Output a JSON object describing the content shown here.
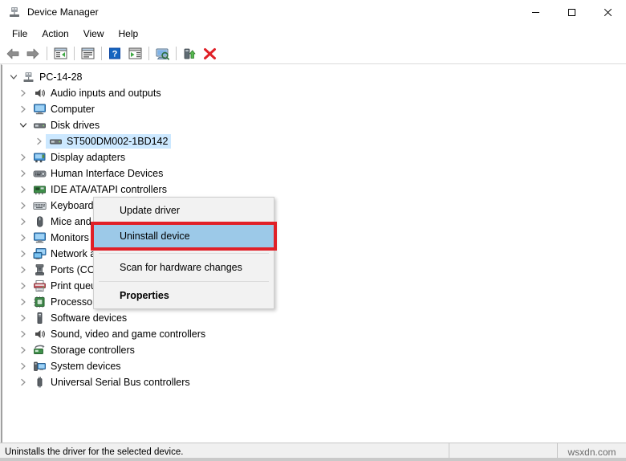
{
  "window": {
    "title": "Device Manager",
    "icon": "device-manager-icon",
    "controls": {
      "minimize": "‒",
      "maximize": "□",
      "close": "✕"
    }
  },
  "menubar": {
    "items": [
      {
        "label": "File"
      },
      {
        "label": "Action"
      },
      {
        "label": "View"
      },
      {
        "label": "Help"
      }
    ]
  },
  "toolbar": {
    "buttons": [
      {
        "name": "back-icon",
        "tip": "Back"
      },
      {
        "name": "forward-icon",
        "tip": "Forward"
      },
      {
        "name": "separator-1",
        "tip": ""
      },
      {
        "name": "show-hide-console-tree-icon",
        "tip": "Show/Hide Console Tree"
      },
      {
        "name": "separator-2",
        "tip": ""
      },
      {
        "name": "properties-icon",
        "tip": "Properties"
      },
      {
        "name": "separator-3",
        "tip": ""
      },
      {
        "name": "help-icon",
        "tip": "Help"
      },
      {
        "name": "view-icon",
        "tip": "View"
      },
      {
        "name": "separator-4",
        "tip": ""
      },
      {
        "name": "scan-for-hardware-changes-icon",
        "tip": "Scan for hardware changes"
      },
      {
        "name": "separator-5",
        "tip": ""
      },
      {
        "name": "update-driver-icon",
        "tip": "Update driver"
      },
      {
        "name": "uninstall-device-icon",
        "tip": "Uninstall device"
      }
    ]
  },
  "tree": {
    "root": {
      "label": "PC-14-28",
      "icon": "computer-root-icon",
      "expanded": true
    },
    "items": [
      {
        "label": "Audio inputs and outputs",
        "icon": "speaker-icon",
        "level": 1,
        "expanded": false
      },
      {
        "label": "Computer",
        "icon": "monitor-icon",
        "level": 1,
        "expanded": false
      },
      {
        "label": "Disk drives",
        "icon": "disk-drive-icon",
        "level": 1,
        "expanded": true
      },
      {
        "label": "ST500DM002-1BD142",
        "icon": "disk-drive-icon",
        "level": 2,
        "expanded": false,
        "selected": true
      },
      {
        "label": "Display adapters",
        "icon": "display-adapter-icon",
        "level": 1,
        "expanded": false
      },
      {
        "label": "Human Interface Devices",
        "icon": "hid-icon",
        "level": 1,
        "expanded": false
      },
      {
        "label": "IDE ATA/ATAPI controllers",
        "icon": "ide-controller-icon",
        "level": 1,
        "expanded": false
      },
      {
        "label": "Keyboards",
        "icon": "keyboard-icon",
        "level": 1,
        "expanded": false
      },
      {
        "label": "Mice and other pointing devices",
        "icon": "mouse-icon",
        "level": 1,
        "expanded": false
      },
      {
        "label": "Monitors",
        "icon": "monitor-icon",
        "level": 1,
        "expanded": false
      },
      {
        "label": "Network adapters",
        "icon": "network-adapter-icon",
        "level": 1,
        "expanded": false
      },
      {
        "label": "Ports (COM & LPT)",
        "icon": "port-icon",
        "level": 1,
        "expanded": false
      },
      {
        "label": "Print queues",
        "icon": "printer-icon",
        "level": 1,
        "expanded": false
      },
      {
        "label": "Processors",
        "icon": "processor-icon",
        "level": 1,
        "expanded": false
      },
      {
        "label": "Software devices",
        "icon": "software-device-icon",
        "level": 1,
        "expanded": false
      },
      {
        "label": "Sound, video and game controllers",
        "icon": "speaker-icon",
        "level": 1,
        "expanded": false
      },
      {
        "label": "Storage controllers",
        "icon": "storage-controller-icon",
        "level": 1,
        "expanded": false
      },
      {
        "label": "System devices",
        "icon": "system-device-icon",
        "level": 1,
        "expanded": false
      },
      {
        "label": "Universal Serial Bus controllers",
        "icon": "usb-icon",
        "level": 1,
        "expanded": false
      }
    ]
  },
  "context_menu": {
    "items": [
      {
        "label": "Update driver",
        "highlighted": false,
        "bold": false
      },
      {
        "label": "Uninstall device",
        "highlighted": true,
        "bold": false
      },
      {
        "label": "Scan for hardware changes",
        "highlighted": false,
        "bold": false
      },
      {
        "label": "Properties",
        "highlighted": false,
        "bold": true
      }
    ]
  },
  "statusbar": {
    "message": "Uninstalls the driver for the selected device.",
    "watermark": "wsxdn.com"
  },
  "colors": {
    "highlight_blue": "#9cc9e8",
    "selection_blue": "#cce8ff",
    "annotation_red": "#e02027",
    "menu_bg": "#f2f2f2",
    "window_bg": "#f0f0f0"
  }
}
